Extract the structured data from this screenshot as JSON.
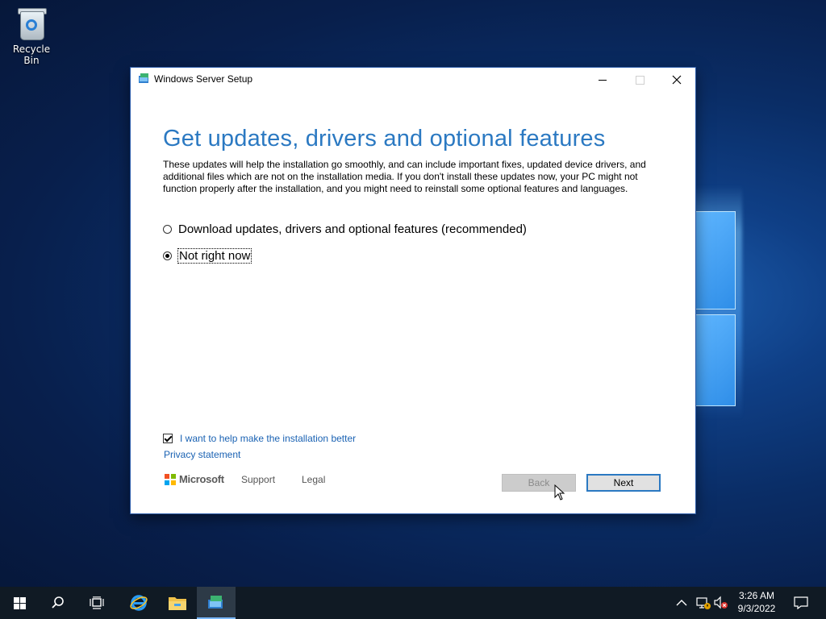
{
  "desktop": {
    "recycle_bin_label": "Recycle Bin"
  },
  "window": {
    "title": "Windows Server Setup",
    "heading": "Get updates, drivers and optional features",
    "description": "These updates will help the installation go smoothly, and can include important fixes, updated device drivers, and additional files which are not on the installation media. If you don't install these updates now, your PC might not function properly after the installation, and you might need to reinstall some optional features and languages.",
    "options": [
      {
        "label": "Download updates, drivers and optional features (recommended)",
        "selected": false
      },
      {
        "label": "Not right now",
        "selected": true
      }
    ],
    "help_checkbox": {
      "label": "I want to help make the installation better",
      "checked": true
    },
    "privacy_link": "Privacy statement",
    "brand": "Microsoft",
    "support_link": "Support",
    "legal_link": "Legal",
    "back_button": "Back",
    "next_button": "Next",
    "colors": {
      "heading": "#2b79c2",
      "link": "#1a62b3",
      "accent": "#2b79c2"
    }
  },
  "taskbar": {
    "items": [
      "start-icon",
      "search-icon",
      "task-view-icon",
      "internet-explorer-icon",
      "file-explorer-icon",
      "setup-icon"
    ],
    "time": "3:26 AM",
    "date": "9/3/2022"
  }
}
